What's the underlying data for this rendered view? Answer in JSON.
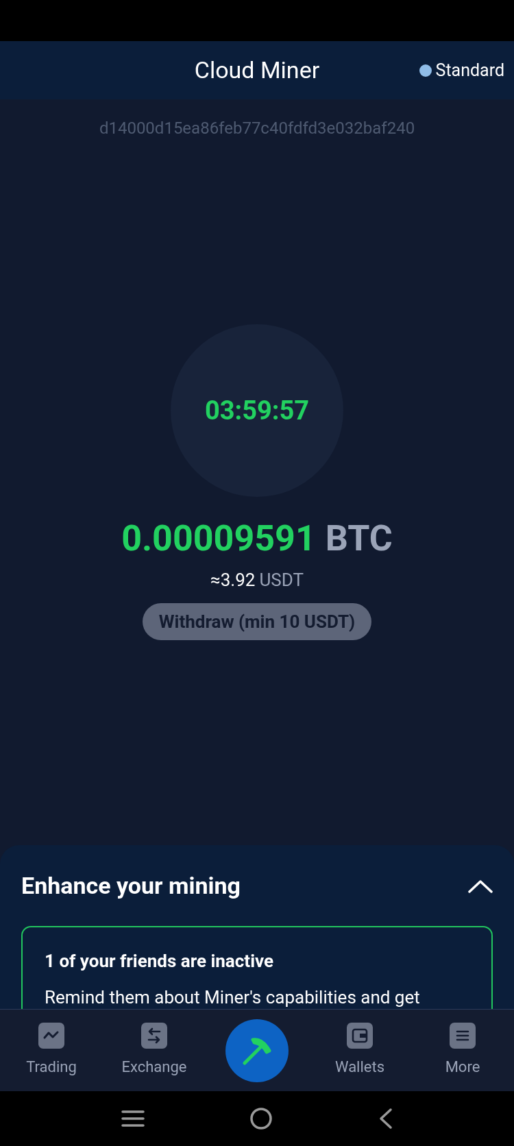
{
  "header": {
    "title": "Cloud Miner",
    "plan": {
      "label": "Standard",
      "color": "#90bde8"
    }
  },
  "wallet_id": "d14000d15ea86feb77c40fdfd3e032baf240",
  "timer": "03:59:57",
  "balance": {
    "amount": "0.00009591",
    "currency": "BTC",
    "approx_value": "≈3.92",
    "approx_currency": "USDT"
  },
  "withdraw_button": {
    "label": "Withdraw (min 10 USDT)",
    "disabled": true
  },
  "sheet": {
    "title": "Enhance your mining",
    "expanded": true,
    "card": {
      "title": "1 of your friends are inactive",
      "text": "Remind them about Miner's capabilities and get"
    }
  },
  "nav": [
    {
      "kind": "trading",
      "label": "Trading",
      "selected": false
    },
    {
      "kind": "exchange",
      "label": "Exchange",
      "selected": false
    },
    {
      "kind": "mining",
      "selected": true
    },
    {
      "kind": "wallets",
      "label": "Wallets",
      "selected": false
    },
    {
      "kind": "more",
      "label": "More",
      "selected": false
    }
  ]
}
